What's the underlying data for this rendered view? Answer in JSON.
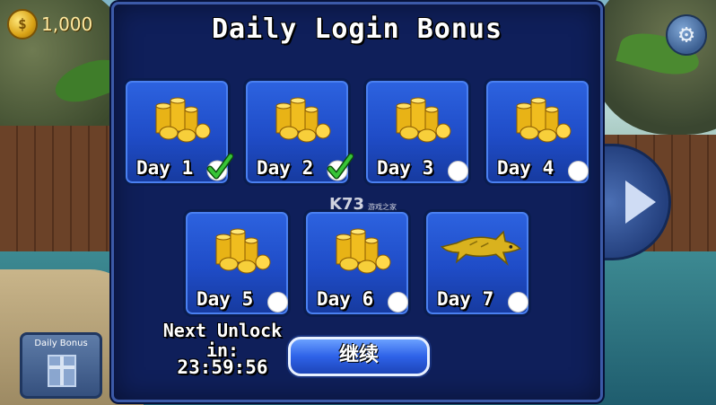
{
  "hud": {
    "coin_symbol": "$",
    "coin_count": "1,000",
    "settings_icon": "gear-icon",
    "daily_bonus_button_label": "Daily Bonus"
  },
  "dialog": {
    "title": "Daily Login Bonus",
    "days": [
      {
        "label": "Day 1",
        "reward": "coins",
        "claimed": true
      },
      {
        "label": "Day 2",
        "reward": "coins",
        "claimed": true
      },
      {
        "label": "Day 3",
        "reward": "coins",
        "claimed": false
      },
      {
        "label": "Day 4",
        "reward": "coins",
        "claimed": false
      },
      {
        "label": "Day 5",
        "reward": "coins",
        "claimed": false
      },
      {
        "label": "Day 6",
        "reward": "coins",
        "claimed": false
      },
      {
        "label": "Day 7",
        "reward": "golden-shark",
        "claimed": false
      }
    ],
    "next_unlock_label": "Next Unlock in:",
    "timer": "23:59:56",
    "continue_button": "继续"
  },
  "watermark": {
    "text": "K73",
    "subtext": "游戏之家"
  },
  "colors": {
    "dialog_bg": "#0f1f5a",
    "card_blue": "#2d63e0",
    "check_green": "#2fbf2f",
    "coin_gold": "#f2c21a"
  }
}
